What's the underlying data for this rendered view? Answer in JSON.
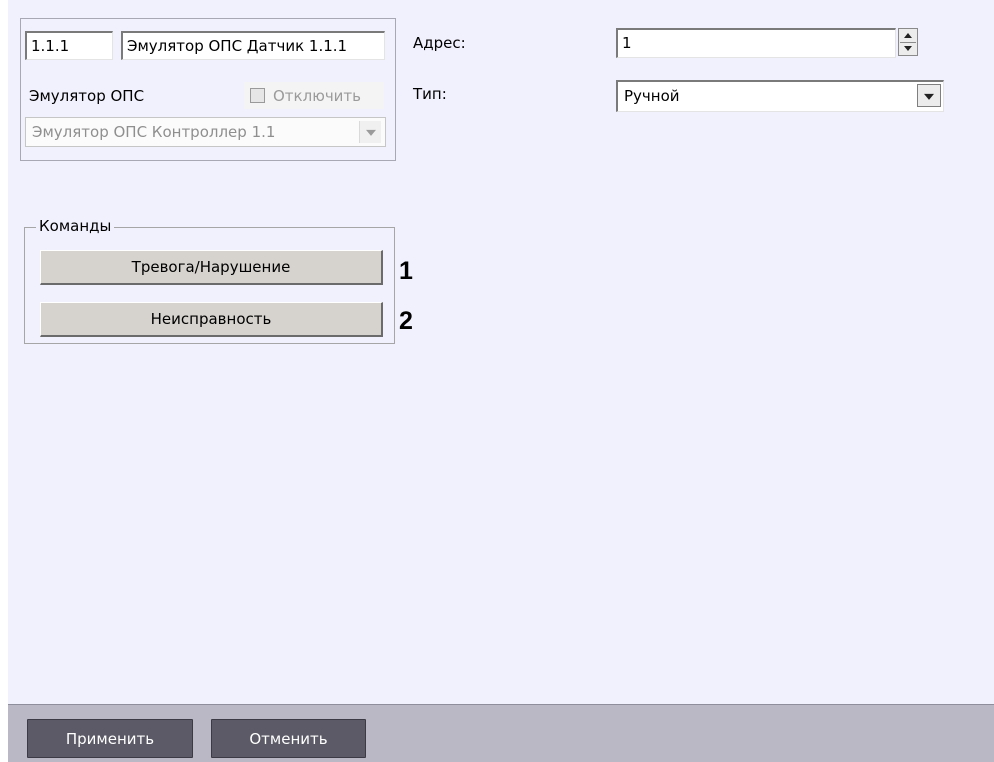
{
  "object": {
    "number": "1.1.1",
    "name": "Эмулятор ОПС Датчик 1.1.1",
    "type_label": "Эмулятор ОПС",
    "disable_label": "Отключить",
    "parent": "Эмулятор ОПС Контроллер 1.1"
  },
  "fields": {
    "address_label": "Адрес:",
    "address_value": "1",
    "type_label": "Тип:",
    "type_value": "Ручной"
  },
  "commands": {
    "title": "Команды",
    "alarm_label": "Тревога/Нарушение",
    "fault_label": "Неисправность",
    "marker_1": "1",
    "marker_2": "2"
  },
  "footer": {
    "apply_label": "Применить",
    "cancel_label": "Отменить"
  }
}
